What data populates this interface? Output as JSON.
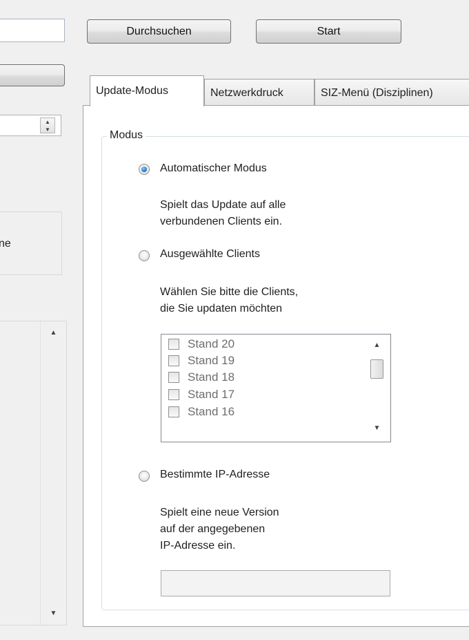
{
  "toolbar": {
    "path_value": "",
    "browse_label": "Durchsuchen",
    "start_label": "Start"
  },
  "left": {
    "cutoff_label": "ne",
    "spinner_value": ""
  },
  "tabs": [
    {
      "label": "Update-Modus",
      "active": true
    },
    {
      "label": "Netzwerkdruck",
      "active": false
    },
    {
      "label": "SIZ-Menü (Disziplinen)",
      "active": false
    }
  ],
  "modus": {
    "group_label": "Modus",
    "auto_label": "Automatischer Modus",
    "auto_desc_1": "Spielt das Update auf alle",
    "auto_desc_2": "verbundenen Clients ein.",
    "selected_label": "Ausgewählte Clients",
    "selected_desc_1": "Wählen Sie bitte die Clients,",
    "selected_desc_2": "die Sie updaten möchten",
    "clients": [
      "Stand 20",
      "Stand 19",
      "Stand 18",
      "Stand 17",
      "Stand 16"
    ],
    "ip_label": "Bestimmte IP-Adresse",
    "ip_desc_1": "Spielt eine neue Version",
    "ip_desc_2": "auf der angegebenen",
    "ip_desc_3": "IP-Adresse ein.",
    "ip_value": ""
  },
  "colors": {
    "background": "#f0f0f0",
    "radio_checked": "#2a7fd4",
    "disabled_text": "#6d6d6d"
  }
}
